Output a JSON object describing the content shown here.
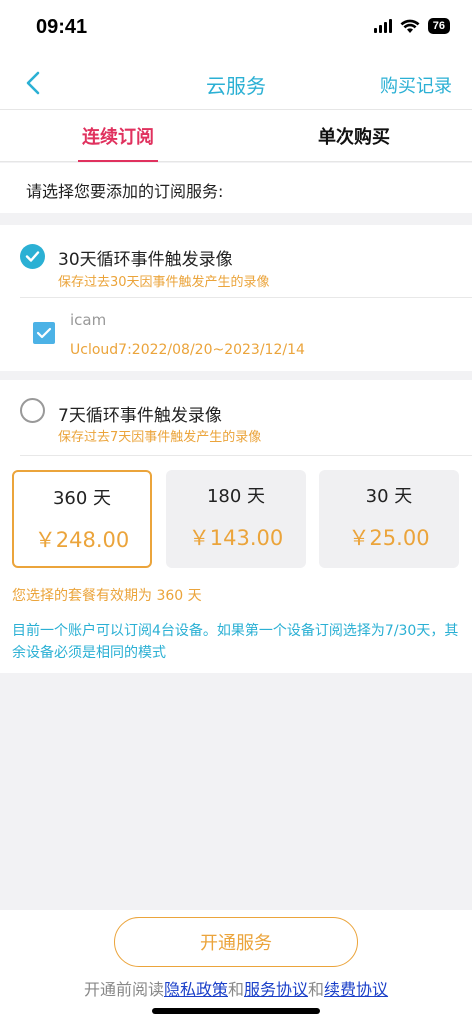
{
  "status_bar": {
    "time": "09:41",
    "battery": "76"
  },
  "nav": {
    "title": "云服务",
    "right_link": "购买记录"
  },
  "tabs": [
    {
      "label": "连续订阅",
      "active": true
    },
    {
      "label": "单次购买",
      "active": false
    }
  ],
  "section_header": "请选择您要添加的订阅服务:",
  "option1": {
    "title": "30天循环事件触发录像",
    "desc": "保存过去30天因事件触发产生的录像",
    "selected": true,
    "device": {
      "name": "icam",
      "detail": "Ucloud7:2022/08/20~2023/12/14",
      "checked": true
    }
  },
  "option2": {
    "title": "7天循环事件触发录像",
    "desc": "保存过去7天因事件触发产生的录像",
    "selected": false
  },
  "plans": [
    {
      "days": "360 天",
      "price": "￥248.00",
      "selected": true
    },
    {
      "days": "180 天",
      "price": "￥143.00",
      "selected": false
    },
    {
      "days": "30 天",
      "price": "￥25.00",
      "selected": false
    }
  ],
  "validity_text": "您选择的套餐有效期为 360 天",
  "notice_text": "目前一个账户可以订阅4台设备。如果第一个设备订阅选择为7/30天，其余设备必须是相同的模式",
  "bottom": {
    "button_label": "开通服务",
    "agreement_prefix": "开通前阅读",
    "privacy_link": "隐私政策",
    "and1": "和",
    "service_link": "服务协议",
    "and2": "和",
    "renewal_link": "续费协议"
  },
  "colors": {
    "accent": "#2bb0d4",
    "tab_active": "#e0315e",
    "price": "#eba43b",
    "link": "#1a3fc8"
  }
}
